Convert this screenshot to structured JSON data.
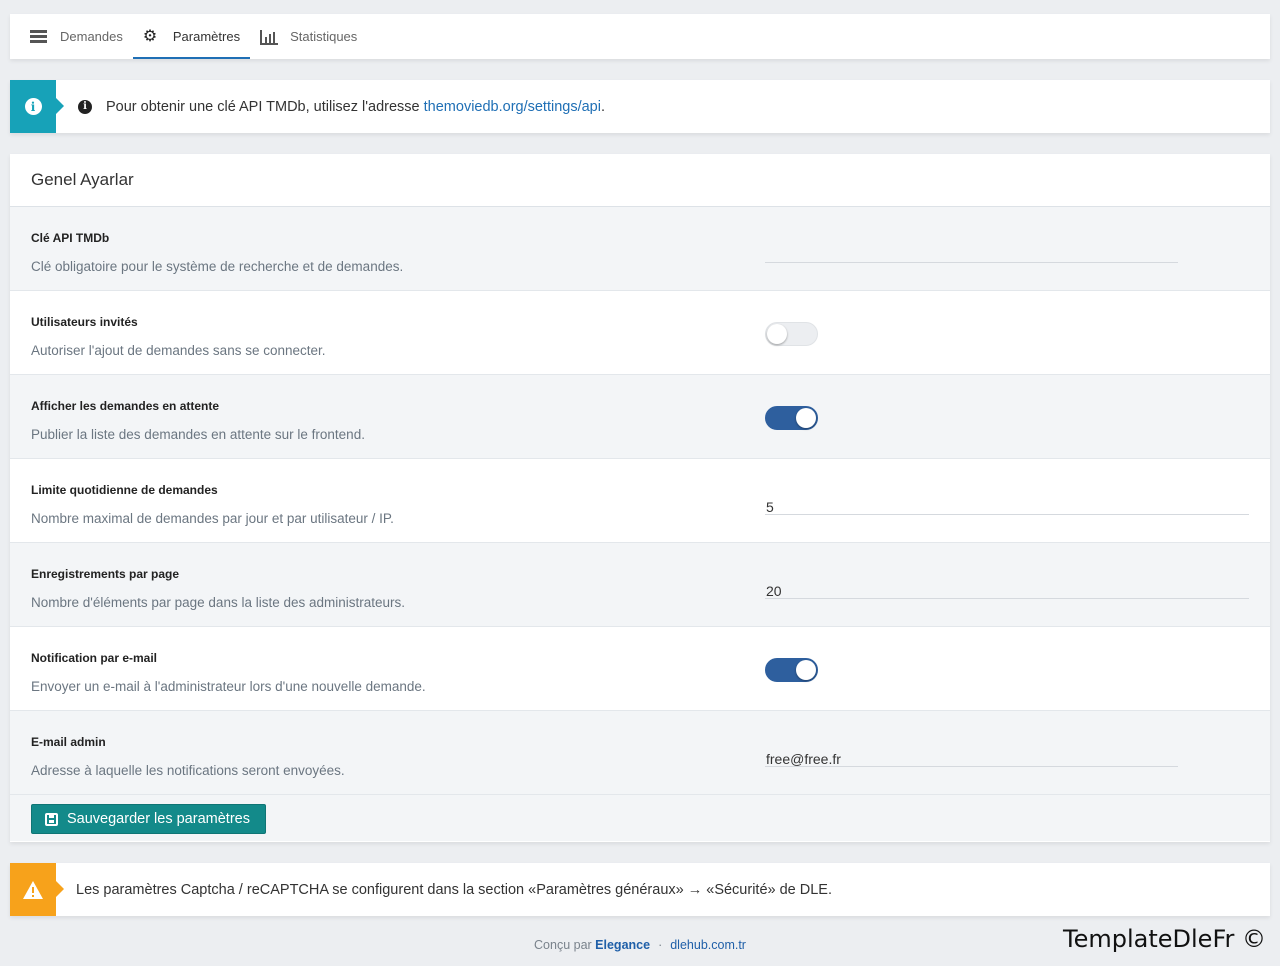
{
  "nav": {
    "items": [
      {
        "label": "Demandes",
        "icon": "list-icon",
        "active": false
      },
      {
        "label": "Paramètres",
        "icon": "gear-icon",
        "active": true
      },
      {
        "label": "Statistiques",
        "icon": "bar-chart-icon",
        "active": false
      }
    ]
  },
  "info_alert": {
    "text": "Pour obtenir une clé API TMDb, utilisez l'adresse ",
    "link": "themoviedb.org/settings/api",
    "suffix": ".",
    "color": "#17a2b8"
  },
  "panel": {
    "title": "Genel Ayarlar",
    "rows": [
      {
        "label": "Clé API TMDb",
        "desc": "Clé obligatoire pour le système de recherche et de demandes.",
        "value": ""
      },
      {
        "label": "Utilisateurs invités",
        "desc": "Autoriser l'ajout de demandes sans se connecter.",
        "toggle": false
      },
      {
        "label": "Afficher les demandes en attente",
        "desc": "Publier la liste des demandes en attente sur le frontend.",
        "toggle": true
      },
      {
        "label": "Limite quotidienne de demandes",
        "desc": "Nombre maximal de demandes par jour et par utilisateur / IP.",
        "value": "5"
      },
      {
        "label": "Enregistrements par page",
        "desc": "Nombre d'éléments par page dans la liste des administrateurs.",
        "value": "20"
      },
      {
        "label": "Notification par e-mail",
        "desc": "Envoyer un e-mail à l'administrateur lors d'une nouvelle demande.",
        "toggle": true
      },
      {
        "label": "E-mail admin",
        "desc": "Adresse à laquelle les notifications seront envoyées.",
        "value": "free@free.fr"
      }
    ],
    "save_label": "Sauvegarder les paramètres",
    "save_color": "#138a8a"
  },
  "warn_alert": {
    "text": "Les paramètres Captcha / reCAPTCHA se configurent dans la section «Paramètres généraux» → «Sécurité» de DLE.",
    "color": "#f7a21b"
  },
  "footer": {
    "prefix": "Conçu par ",
    "brand": "Elegance",
    "separator": "·",
    "site": "dlehub.com.tr"
  },
  "watermark": "TemplateDleFr ©"
}
